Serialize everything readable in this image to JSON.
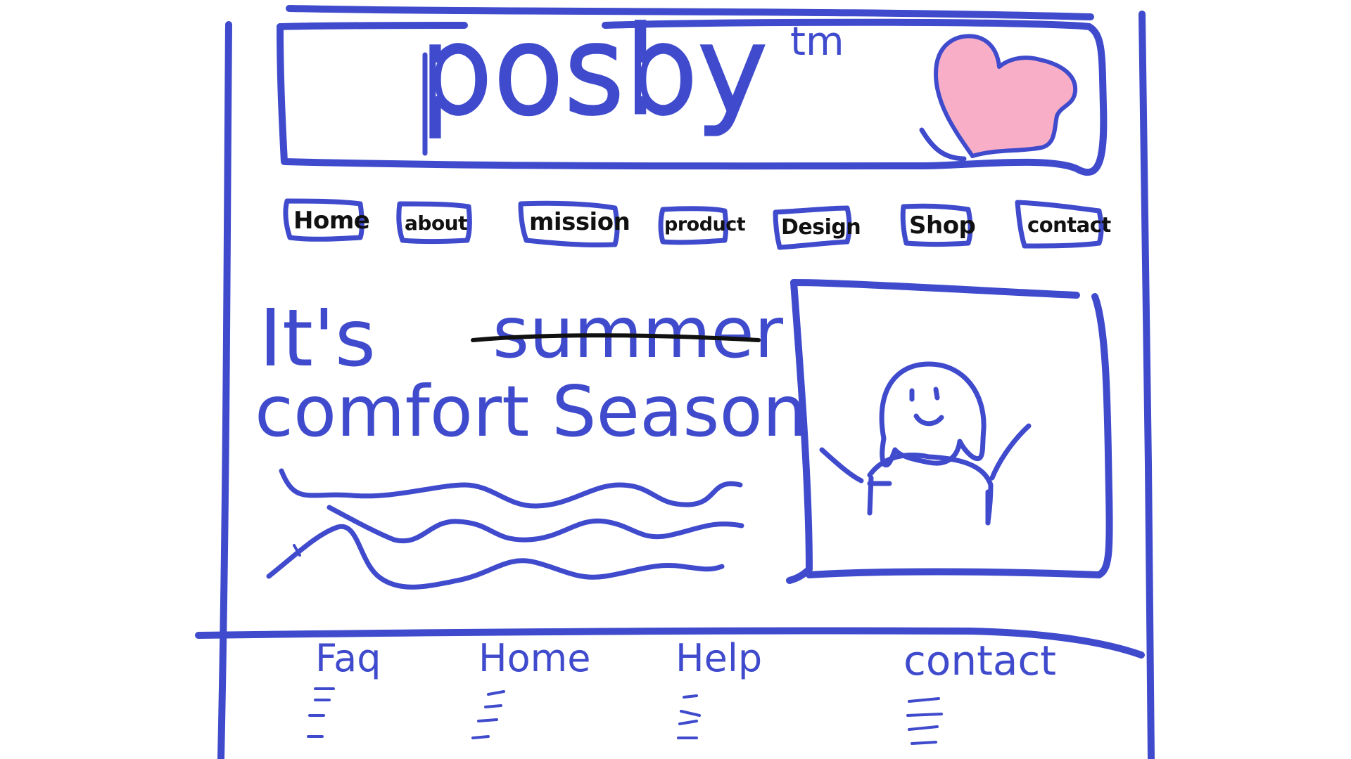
{
  "colors": {
    "ink": "#3f4bcc",
    "heart": "#f9aec7",
    "text": "#111111",
    "background": "#ffffff"
  },
  "header": {
    "logo_text": "posby",
    "trademark": "tm",
    "logo_icon": "heart-icon"
  },
  "nav": {
    "items": [
      {
        "label": "Home"
      },
      {
        "label": "about"
      },
      {
        "label": "mission"
      },
      {
        "label": "product"
      },
      {
        "label": "Design"
      },
      {
        "label": "Shop"
      },
      {
        "label": "contact"
      }
    ]
  },
  "hero": {
    "line1_prefix": "It's",
    "struck_word": "summer",
    "line2": "comfort Season",
    "image_icon": "person-waving-icon"
  },
  "footer": {
    "columns": [
      {
        "title": "Faq"
      },
      {
        "title": "Home"
      },
      {
        "title": "Help"
      },
      {
        "title": "contact"
      }
    ]
  }
}
